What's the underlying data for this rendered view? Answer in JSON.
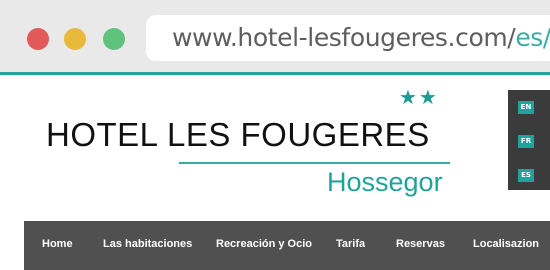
{
  "browser": {
    "url_domain": "www.hotel-lesfougeres.com/",
    "url_path": "es/"
  },
  "header": {
    "stars": "★★",
    "hotel_name": "HOTEL LES FOUGERES",
    "location": "Hossegor"
  },
  "languages": [
    "EN",
    "FR",
    "ES"
  ],
  "nav": {
    "items": [
      "Home",
      "Las habitaciones",
      "Recreación y Ocio",
      "Tarifa",
      "Reservas",
      "Localisazion"
    ]
  },
  "colors": {
    "accent": "#1fa39a",
    "nav_bg": "#505050",
    "lang_panel_bg": "#3b3b3b"
  }
}
